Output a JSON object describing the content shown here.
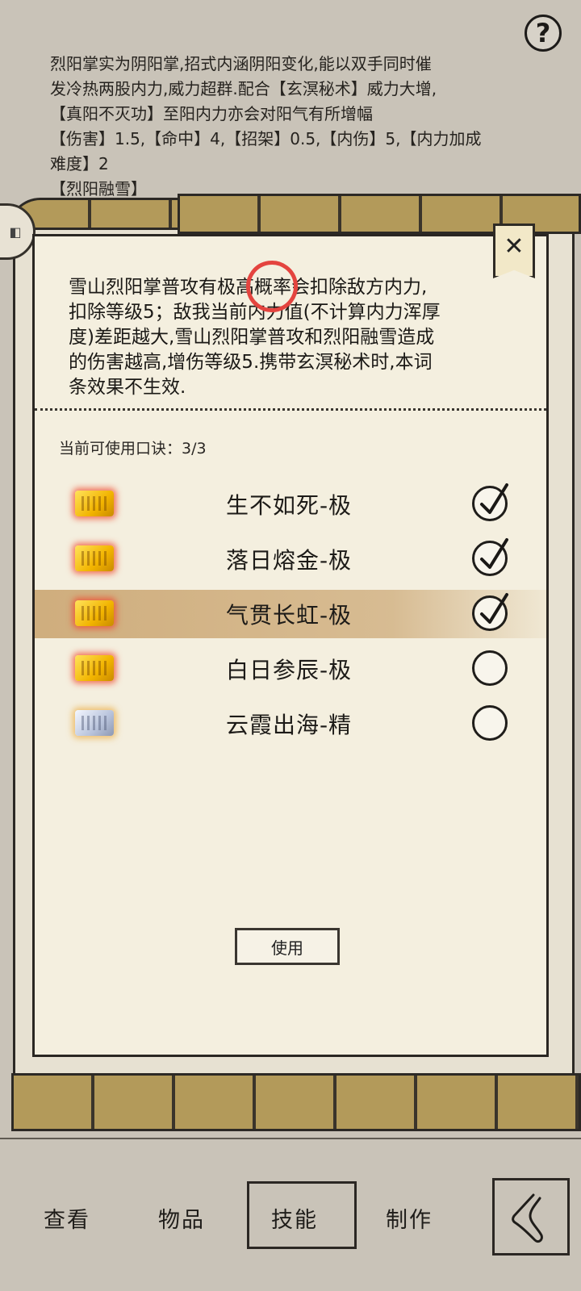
{
  "background": {
    "description_lines": [
      "烈阳掌实为阴阳掌,招式内涵阴阳变化,能以双手同时催",
      "发冷热两股内力,威力超群.配合【玄溟秘术】威力大增,",
      "【真阳不灭功】至阳内力亦会对阳气有所增幅",
      "【伤害】1.5,【命中】4,【招架】0.5,【内伤】5,【内力加成",
      "         难度】2",
      "              【烈阳融雪】"
    ]
  },
  "help_icon": "?",
  "modal": {
    "close_icon": "✕",
    "effect_lines": [
      "雪山烈阳掌普攻有极高概率会扣除敌方内力,",
      "扣除等级5；敌我当前内力值(不计算内力浑厚",
      "度)差距越大,雪山烈阳掌普攻和烈阳融雪造成",
      "的伤害越高,增伤等级5.携带玄溟秘术时,本词",
      "条效果不生效."
    ],
    "usable_label": "当前可使用口诀：3/3",
    "skills": [
      {
        "name": "生不如死-极",
        "checked": true,
        "token": "gold"
      },
      {
        "name": "落日熔金-极",
        "checked": true,
        "token": "gold"
      },
      {
        "name": "气贯长虹-极",
        "checked": true,
        "token": "gold",
        "highlighted": true
      },
      {
        "name": "白日参辰-极",
        "checked": false,
        "token": "gold"
      },
      {
        "name": "云霞出海-精",
        "checked": false,
        "token": "silver"
      }
    ],
    "use_button": "使用"
  },
  "nav": {
    "items": [
      "查看",
      "物品",
      "技能",
      "制作"
    ],
    "active": "技能",
    "back_icon": "back-arrow-icon"
  },
  "colors": {
    "annotation_circle": "#e4443f",
    "modal_bg": "#f4efdf",
    "highlight_row": "#d2b48a"
  }
}
